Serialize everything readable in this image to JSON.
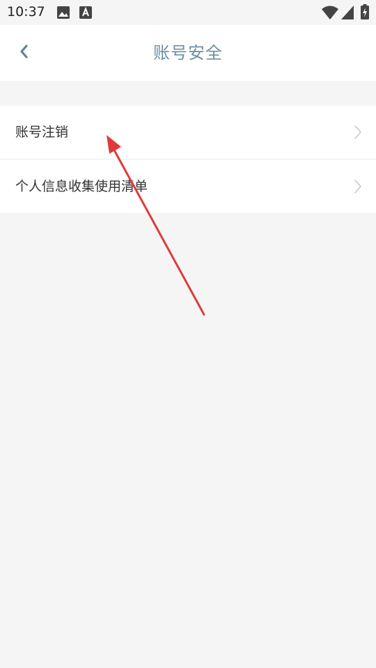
{
  "status_bar": {
    "time": "10:37",
    "icons": [
      "image-icon",
      "text-a-icon",
      "wifi-icon",
      "signal-icon",
      "battery-charging-icon"
    ]
  },
  "nav": {
    "back_icon": "chevron-left-icon",
    "title": "账号安全"
  },
  "list": {
    "items": [
      {
        "label": "账号注销",
        "icon": "chevron-right-icon"
      },
      {
        "label": "个人信息收集使用清单",
        "icon": "chevron-right-icon"
      }
    ]
  },
  "colors": {
    "background": "#f5f5f5",
    "surface": "#ffffff",
    "title": "#6f8fa3",
    "text": "#333333",
    "chevron": "#c8c8c8",
    "annotation_arrow": "#e03a3a"
  }
}
